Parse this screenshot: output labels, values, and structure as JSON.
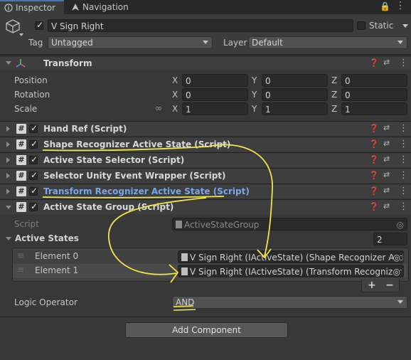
{
  "tabs": [
    {
      "label": "Inspector",
      "icon": "info-icon",
      "active": true
    },
    {
      "label": "Navigation",
      "icon": "navigation-icon",
      "active": false
    }
  ],
  "header": {
    "object_name": "V Sign Right",
    "static_label": "Static",
    "tag_label": "Tag",
    "tag_value": "Untagged",
    "layer_label": "Layer",
    "layer_value": "Default"
  },
  "transform": {
    "title": "Transform",
    "rows": [
      {
        "label": "Position",
        "x": "0",
        "y": "0",
        "z": "0"
      },
      {
        "label": "Rotation",
        "x": "0",
        "y": "0",
        "z": "0"
      },
      {
        "label": "Scale",
        "x": "1",
        "y": "1",
        "z": "1"
      }
    ],
    "axis_x": "X",
    "axis_y": "Y",
    "axis_z": "Z"
  },
  "components": [
    {
      "title": "Hand Ref (Script)",
      "highlight": false
    },
    {
      "title": "Shape Recognizer Active State (Script)",
      "highlight": false
    },
    {
      "title": "Active State Selector (Script)",
      "highlight": false
    },
    {
      "title": "Selector Unity Event Wrapper (Script)",
      "highlight": false
    },
    {
      "title": "Transform Recognizer Active State (Script)",
      "highlight": true
    },
    {
      "title": "Active State Group (Script)",
      "highlight": false
    }
  ],
  "group": {
    "script_label": "Script",
    "script_value": "ActiveStateGroup",
    "active_states_label": "Active States",
    "active_states_count": "2",
    "elements": [
      {
        "label": "Element 0",
        "value": "V Sign Right (IActiveState) (Shape Recognizer Acti"
      },
      {
        "label": "Element 1",
        "value": "V Sign Right (IActiveState) (Transform Recognizer A"
      }
    ],
    "add_symbol": "+",
    "remove_symbol": "−",
    "logic_label": "Logic Operator",
    "logic_value": "AND"
  },
  "add_component_label": "Add Component",
  "colors": {
    "accent": "#3a79bb",
    "highlight_text": "#7aa7e8",
    "annotation": "#f2e44a"
  }
}
